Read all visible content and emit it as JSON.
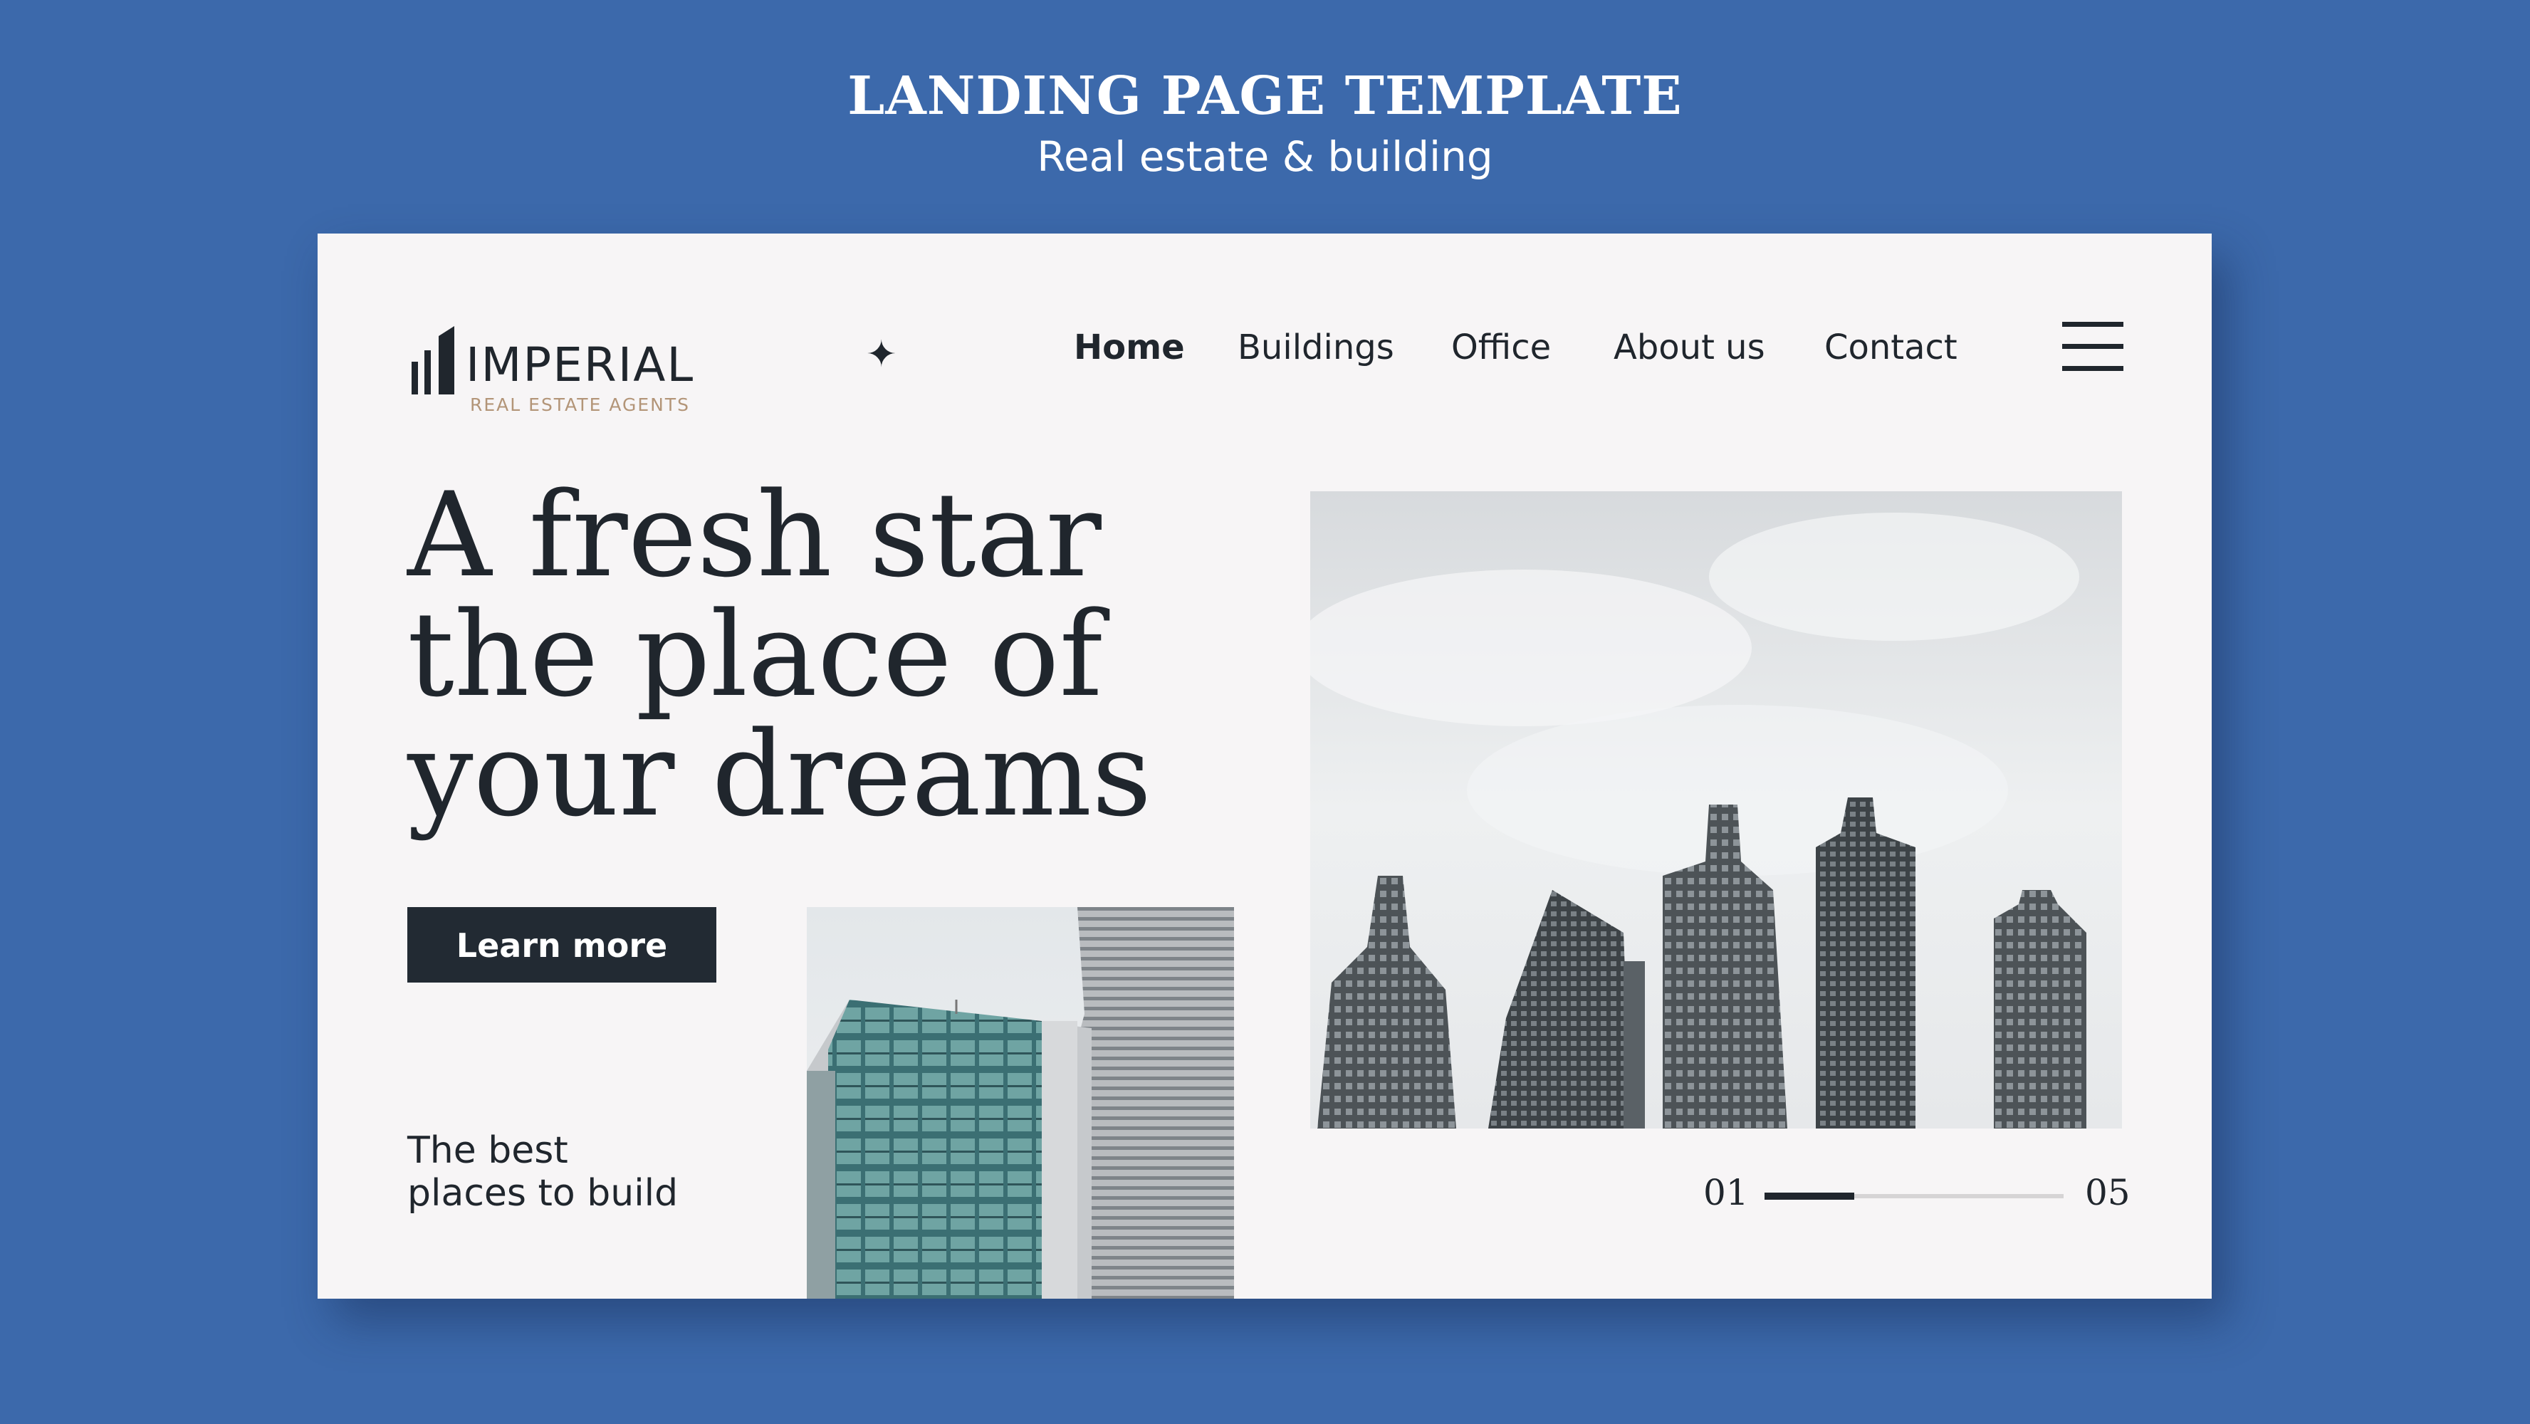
{
  "header": {
    "title": "LANDING PAGE TEMPLATE",
    "subtitle": "Real estate & building"
  },
  "logo": {
    "name": "IMPERIAL",
    "tagline": "REAL ESTATE AGENTS"
  },
  "nav": {
    "items": [
      {
        "label": "Home",
        "active": true
      },
      {
        "label": "Buildings",
        "active": false
      },
      {
        "label": "Office",
        "active": false
      },
      {
        "label": "About us",
        "active": false
      },
      {
        "label": "Contact",
        "active": false
      }
    ],
    "menu_icon": "hamburger-menu-icon",
    "star_icon": "four-point-star-icon"
  },
  "hero": {
    "headline": "A fresh star the place of your dreams",
    "button_label": "Learn more",
    "tagline_line1": "The best",
    "tagline_line2": "places to build"
  },
  "slider": {
    "current": "01",
    "total": "05",
    "progress": 0.3
  },
  "colors": {
    "background": "#3c69ab",
    "card": "#f7f5f6",
    "text_dark": "#20262d",
    "accent_gold": "#b39578",
    "button": "#222a33"
  }
}
